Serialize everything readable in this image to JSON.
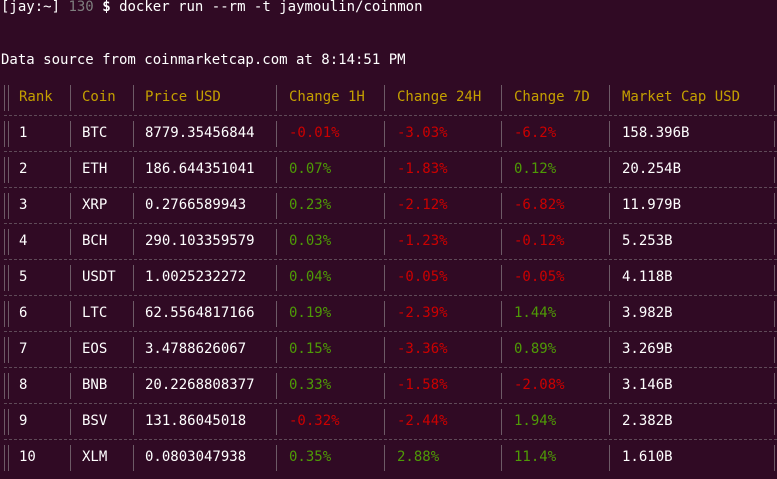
{
  "prompt": {
    "user_host": "[jay:~]",
    "exit_code": "130",
    "dollar": "$",
    "command": "docker run --rm -t jaymoulin/coinmon"
  },
  "source_line": "Data source from coinmarketcap.com at 8:14:51 PM",
  "columns": [
    "Rank",
    "Coin",
    "Price USD",
    "Change 1H",
    "Change 24H",
    "Change 7D",
    "Market Cap USD"
  ],
  "rows": [
    {
      "rank": "1",
      "coin": "BTC",
      "price": "8779.35456844",
      "ch1h": "-0.01%",
      "ch24h": "-3.03%",
      "ch7d": "-6.2%",
      "mcap": "158.396B"
    },
    {
      "rank": "2",
      "coin": "ETH",
      "price": "186.644351041",
      "ch1h": "0.07%",
      "ch24h": "-1.83%",
      "ch7d": "0.12%",
      "mcap": "20.254B"
    },
    {
      "rank": "3",
      "coin": "XRP",
      "price": "0.2766589943",
      "ch1h": "0.23%",
      "ch24h": "-2.12%",
      "ch7d": "-6.82%",
      "mcap": "11.979B"
    },
    {
      "rank": "4",
      "coin": "BCH",
      "price": "290.103359579",
      "ch1h": "0.03%",
      "ch24h": "-1.23%",
      "ch7d": "-0.12%",
      "mcap": "5.253B"
    },
    {
      "rank": "5",
      "coin": "USDT",
      "price": "1.0025232272",
      "ch1h": "0.04%",
      "ch24h": "-0.05%",
      "ch7d": "-0.05%",
      "mcap": "4.118B"
    },
    {
      "rank": "6",
      "coin": "LTC",
      "price": "62.5564817166",
      "ch1h": "0.19%",
      "ch24h": "-2.39%",
      "ch7d": "1.44%",
      "mcap": "3.982B"
    },
    {
      "rank": "7",
      "coin": "EOS",
      "price": "3.4788626067",
      "ch1h": "0.15%",
      "ch24h": "-3.36%",
      "ch7d": "0.89%",
      "mcap": "3.269B"
    },
    {
      "rank": "8",
      "coin": "BNB",
      "price": "20.2268808377",
      "ch1h": "0.33%",
      "ch24h": "-1.58%",
      "ch7d": "-2.08%",
      "mcap": "3.146B"
    },
    {
      "rank": "9",
      "coin": "BSV",
      "price": "131.86045018",
      "ch1h": "-0.32%",
      "ch24h": "-2.44%",
      "ch7d": "1.94%",
      "mcap": "2.382B"
    },
    {
      "rank": "10",
      "coin": "XLM",
      "price": "0.0803047938",
      "ch1h": "0.35%",
      "ch24h": "2.88%",
      "ch7d": "11.4%",
      "mcap": "1.610B"
    }
  ],
  "colors": {
    "background": "#300a24",
    "header": "#c4a000",
    "negative": "#cc0000",
    "positive": "#4e9a06",
    "text": "#ffffff",
    "exit_code": "#7f7f7f"
  }
}
